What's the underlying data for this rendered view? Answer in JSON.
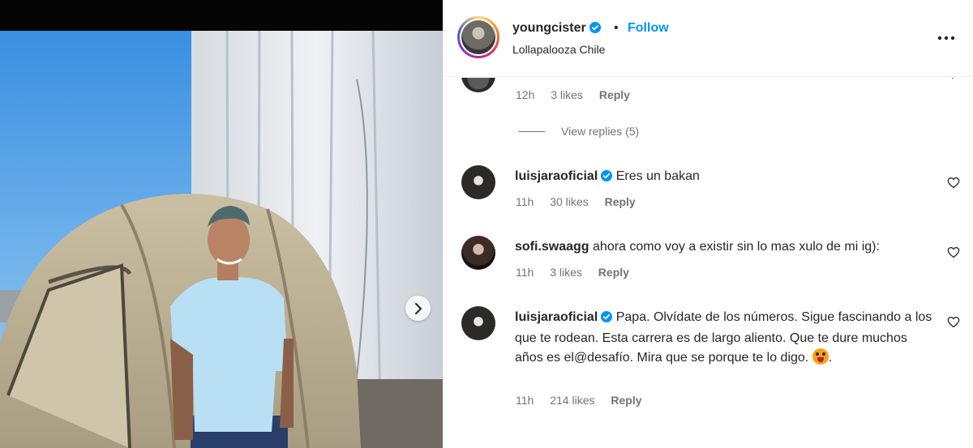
{
  "header": {
    "username": "youngcister",
    "verified": true,
    "separator": "•",
    "follow_label": "Follow",
    "location": "Lollapalooza Chile",
    "more_icon": "more-horizontal-icon"
  },
  "thread_top": {
    "time": "12h",
    "likes": "3 likes",
    "reply": "Reply",
    "view_replies": "View replies (5)"
  },
  "comments": [
    {
      "username": "luisjaraoficial",
      "verified": true,
      "text": "Eres un bakan",
      "time": "11h",
      "likes": "30 likes",
      "reply": "Reply"
    },
    {
      "username": "sofi.swaagg",
      "verified": false,
      "text": "ahora como voy a existir sin lo mas xulo de mi ig):",
      "time": "11h",
      "likes": "3 likes",
      "reply": "Reply"
    },
    {
      "username": "luisjaraoficial",
      "verified": true,
      "text": "Papa. Olvídate de los números. Sigue fascinando a los que te rodean. Esta carrera es de largo aliento. Que te dure muchos años es el@desafío. Mira que se porque te lo digo.",
      "emoji": "tongue-out-emoji",
      "time": "11h",
      "likes": "214 likes",
      "reply": "Reply"
    }
  ],
  "colors": {
    "follow_blue": "#0095f6",
    "verified_blue": "#0095f6",
    "meta_gray": "#737373",
    "text": "#262626"
  },
  "carousel_next_icon": "chevron-right-icon"
}
